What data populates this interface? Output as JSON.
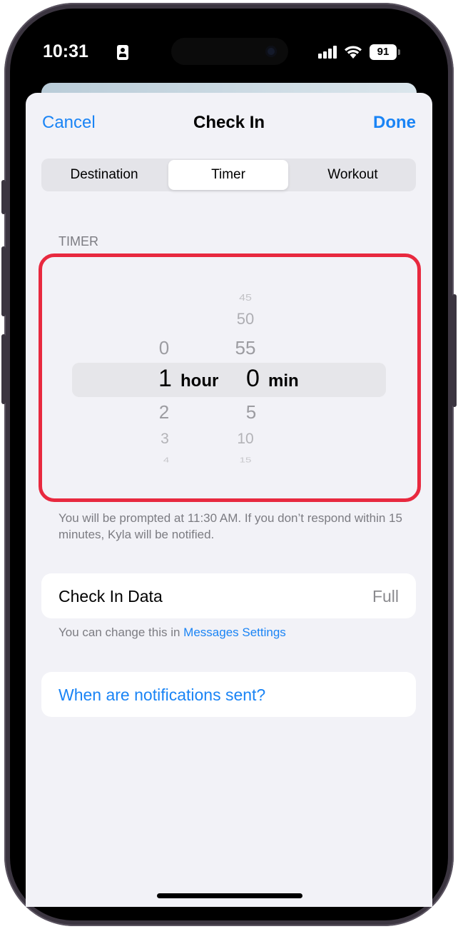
{
  "status_bar": {
    "time": "10:31",
    "battery": "91"
  },
  "nav": {
    "cancel": "Cancel",
    "title": "Check In",
    "done": "Done"
  },
  "segments": [
    {
      "label": "Destination",
      "selected": false
    },
    {
      "label": "Timer",
      "selected": true
    },
    {
      "label": "Workout",
      "selected": false
    }
  ],
  "timer": {
    "section_label": "TIMER",
    "hours_above": [
      "0"
    ],
    "hours_selected": "1",
    "hours_below": [
      "2",
      "3",
      "4"
    ],
    "hour_unit": "hour",
    "minutes_above": [
      "45",
      "50",
      "55"
    ],
    "minutes_selected": "0",
    "minutes_below": [
      "5",
      "10",
      "15"
    ],
    "minute_unit": "min"
  },
  "prompt_text": "You will be prompted at 11:30 AM. If you don’t respond within 15 minutes, Kyla will be notified.",
  "check_in_data": {
    "label": "Check In Data",
    "value": "Full"
  },
  "hint": {
    "text": "You can change this in ",
    "link": "Messages Settings"
  },
  "notifications_link": "When are notifications sent?",
  "colors": {
    "accent": "#1a84f5",
    "highlight_frame": "#e8293f",
    "background": "#f2f2f7"
  }
}
